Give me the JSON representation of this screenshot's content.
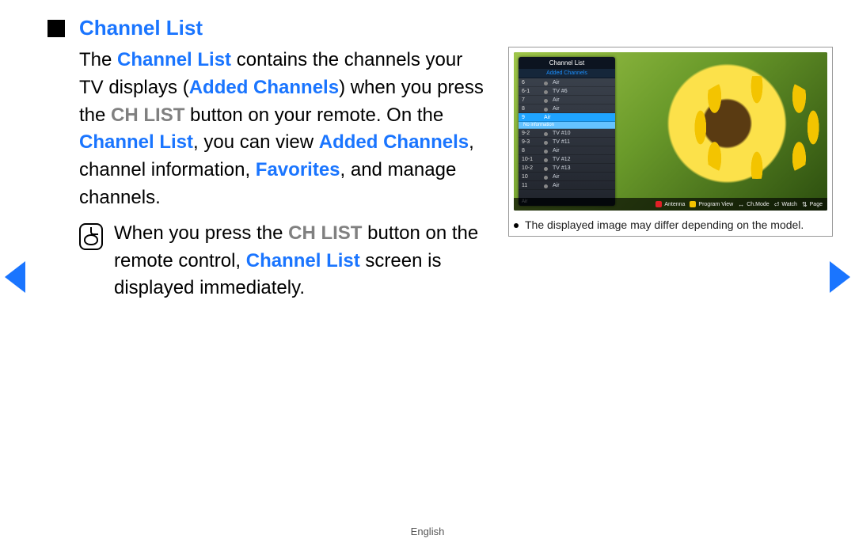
{
  "heading": "Channel List",
  "body": {
    "t1": "The ",
    "t2": "Channel List",
    "t3": " contains the channels your TV displays (",
    "t4": "Added Channels",
    "t5": ") when you press the ",
    "t6": "CH LIST",
    "t7": " button on your remote. On the ",
    "t8": "Channel List",
    "t9": ", you can view ",
    "t10": "Added Channels",
    "t11": ", channel information, ",
    "t12": "Favorites",
    "t13": ", and manage channels."
  },
  "note": {
    "n1": "When you press the ",
    "n2": "CH LIST",
    "n3": " button on the remote control, ",
    "n4": "Channel List",
    "n5": " screen is displayed immediately."
  },
  "osd": {
    "title": "Channel List",
    "subtitle": "Added Channels",
    "rows": [
      {
        "num": "6",
        "name": "Air"
      },
      {
        "num": "6-1",
        "name": "TV #6"
      },
      {
        "num": "7",
        "name": "Air"
      },
      {
        "num": "8",
        "name": "Air"
      }
    ],
    "selected": {
      "num": "9",
      "name": "Air"
    },
    "selected_sub": "No information",
    "rows2": [
      {
        "num": "9-2",
        "name": "TV #10"
      },
      {
        "num": "9-3",
        "name": "TV #11"
      },
      {
        "num": "8",
        "name": "Air"
      },
      {
        "num": "10-1",
        "name": "TV #12"
      },
      {
        "num": "10-2",
        "name": "TV #13"
      },
      {
        "num": "10",
        "name": "Air"
      },
      {
        "num": "11",
        "name": "Air"
      }
    ],
    "footer_left": "Air",
    "legend": {
      "antenna": "Antenna",
      "program": "Program View",
      "chmode": "Ch.Mode",
      "watch": "Watch",
      "page": "Page"
    }
  },
  "caption": "The displayed image may differ depending on the model.",
  "page_lang": "English"
}
